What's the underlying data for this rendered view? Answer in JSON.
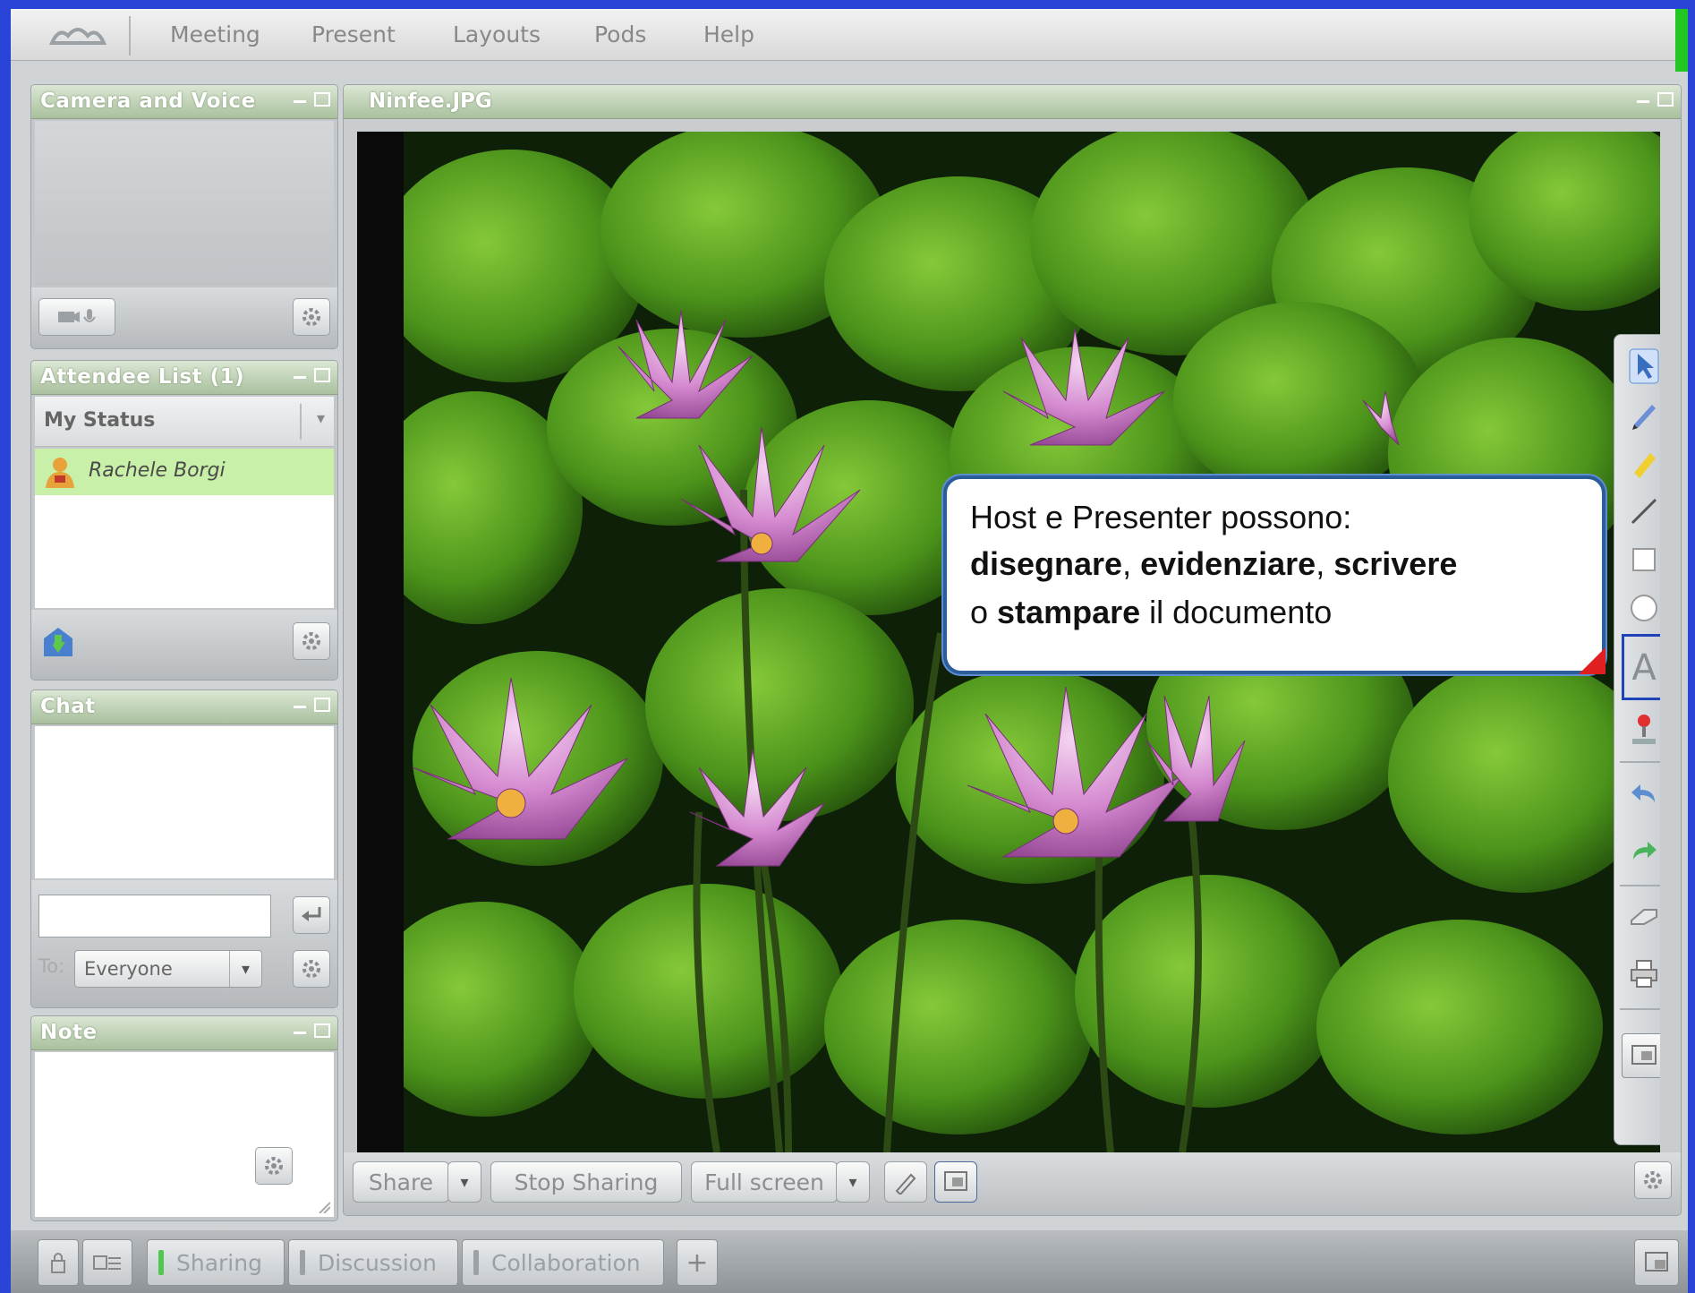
{
  "menubar": {
    "items": [
      "Meeting",
      "Present",
      "Layouts",
      "Pods",
      "Help"
    ]
  },
  "pods": {
    "camera": {
      "title": "Camera and Voice"
    },
    "attendees": {
      "title": "Attendee List (1)",
      "my_status": "My Status",
      "attendee_name": "Rachele Borgi"
    },
    "chat": {
      "title": "Chat",
      "input_value": "",
      "to_label": "To:",
      "to_value": "Everyone"
    },
    "note": {
      "title": "Note"
    }
  },
  "share": {
    "title": "Ninfee.JPG",
    "callout": {
      "line1": "Host e Presenter possono:",
      "line2_b1": "disegnare",
      "line2_s1": ", ",
      "line2_b2": "evidenziare",
      "line2_s2": ", ",
      "line2_b3": "scrivere",
      "line3_a": "o ",
      "line3_b": "stampare",
      "line3_c": " il documento"
    },
    "tools": [
      "pointer-icon",
      "pencil-icon",
      "highlighter-icon",
      "line-icon",
      "rectangle-icon",
      "ellipse-icon",
      "text-icon",
      "stamp-icon",
      "undo-icon",
      "redo-icon",
      "eraser-icon",
      "print-icon",
      "screen-icon"
    ],
    "footer": {
      "share_label": "Share",
      "stop_label": "Stop Sharing",
      "fullscreen_label": "Full screen"
    }
  },
  "bottombar": {
    "tabs": [
      "Sharing",
      "Discussion",
      "Collaboration"
    ],
    "add_label": "+"
  },
  "colors": {
    "pod_title_green": "#a9c09d",
    "attendee_highlight": "#c9f0a8",
    "callout_border": "#2b5d9a",
    "selected_tool": "#1f43b8"
  }
}
